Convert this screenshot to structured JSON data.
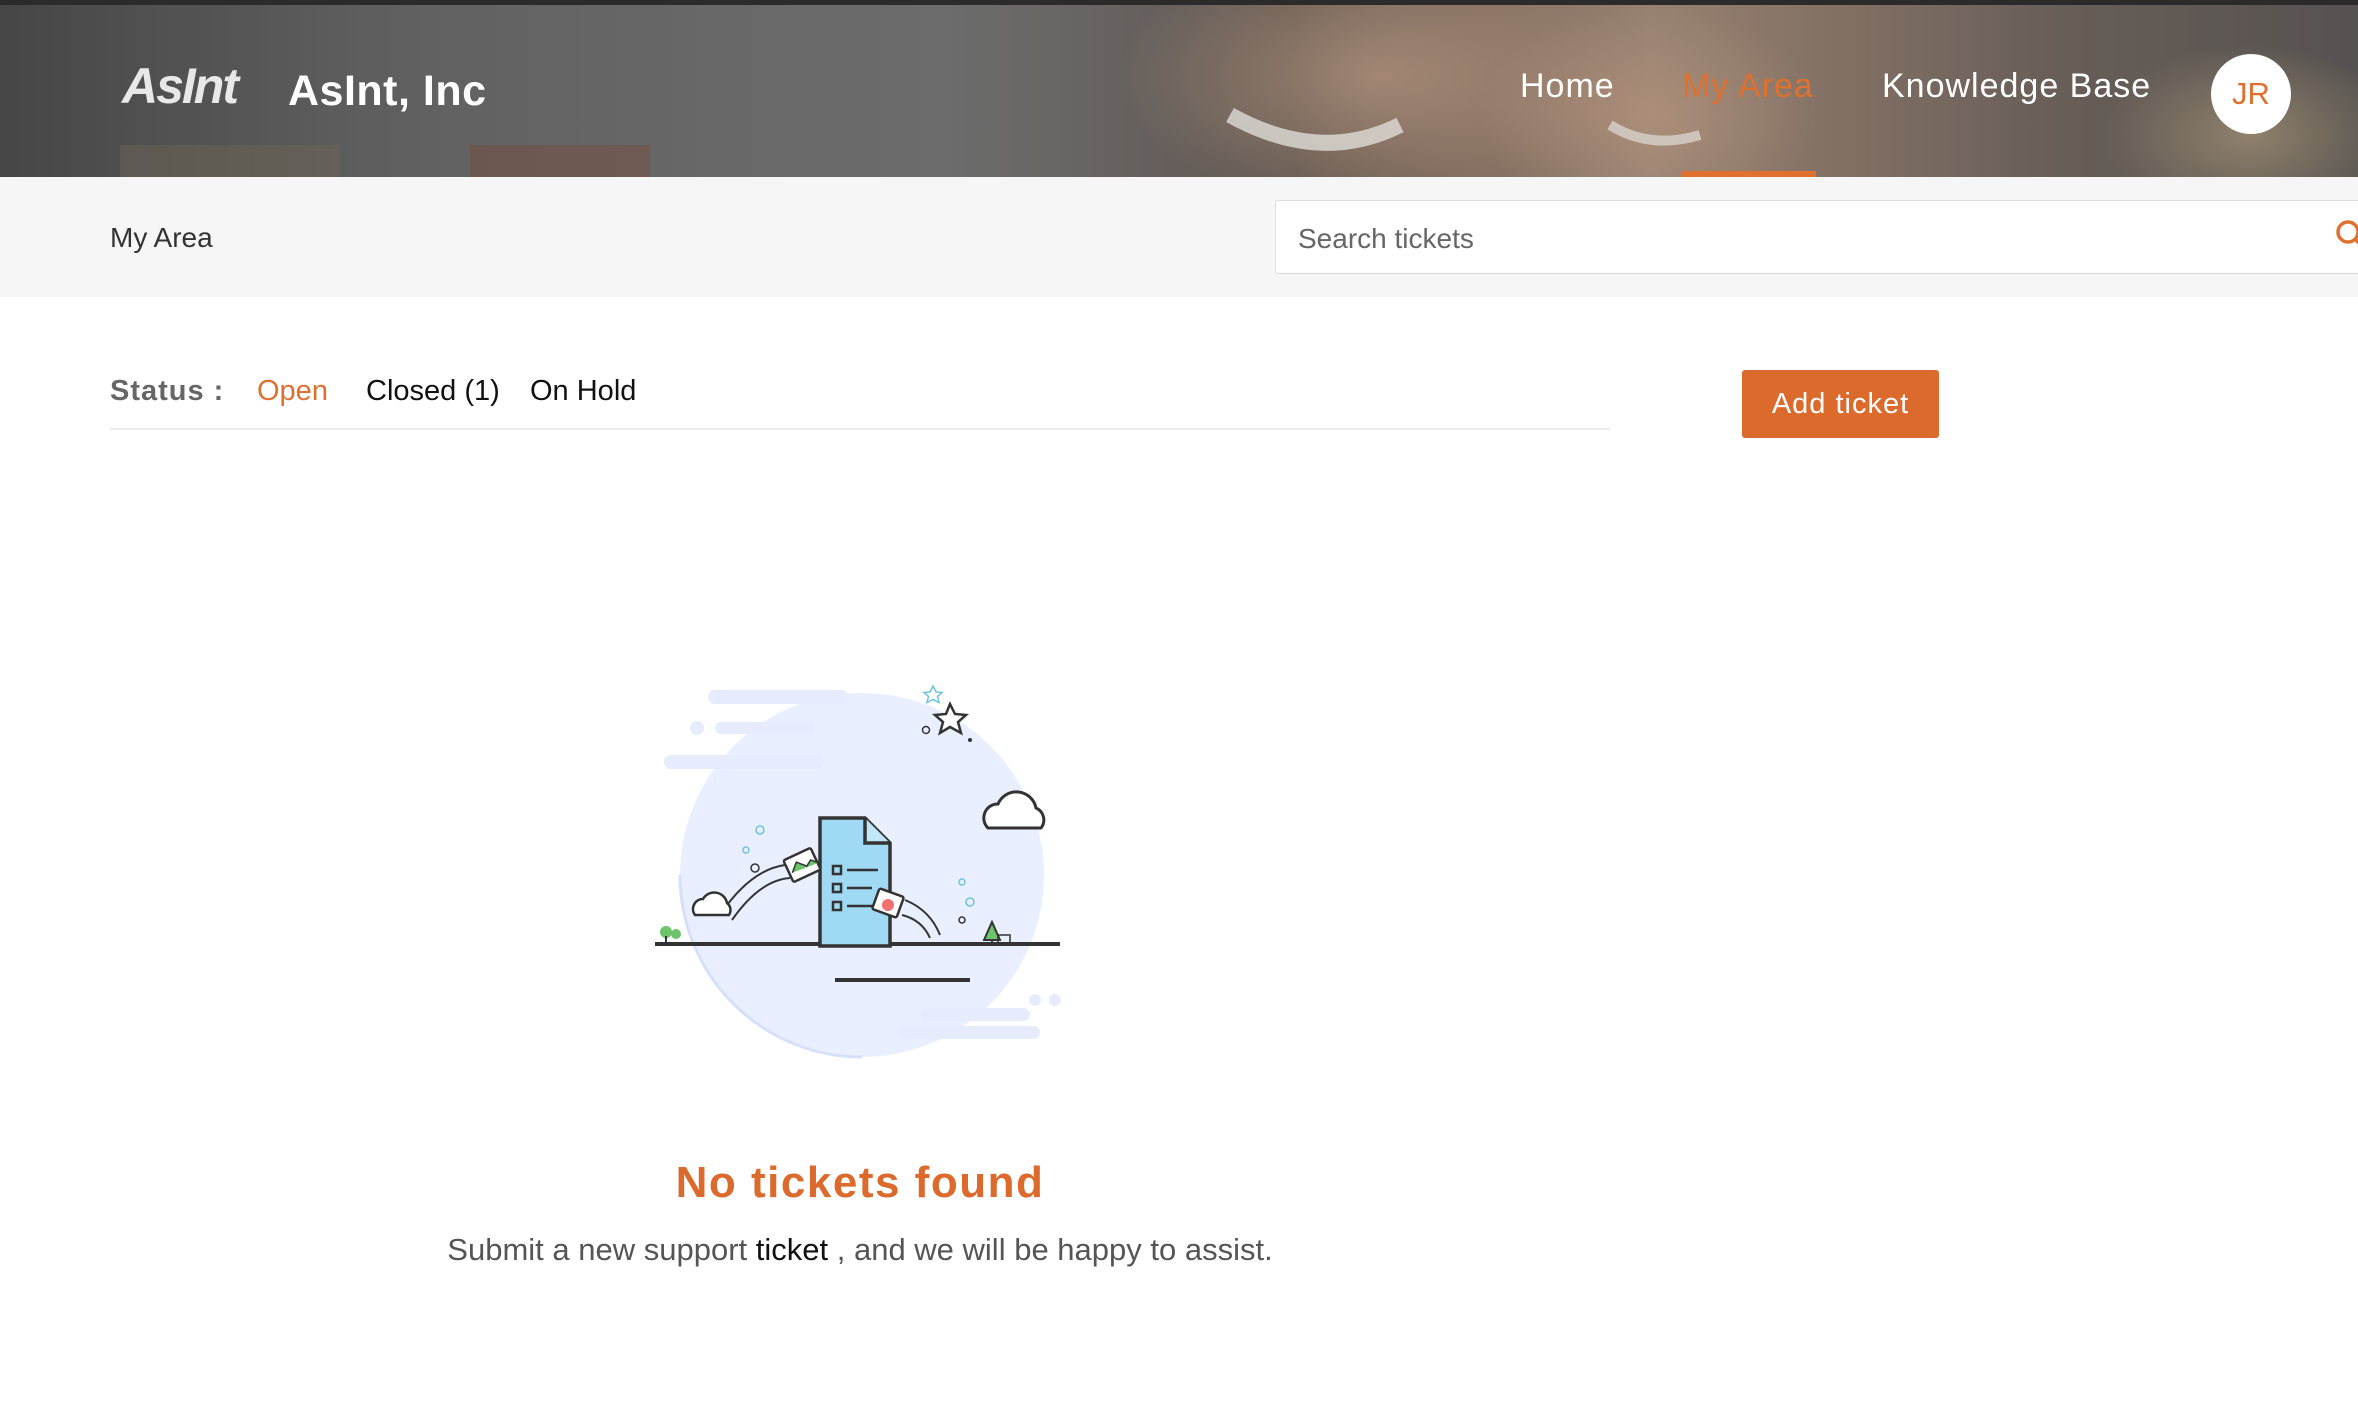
{
  "header": {
    "logo_text": "AsInt",
    "brand": "AsInt, Inc",
    "nav": [
      {
        "label": "Home",
        "active": false
      },
      {
        "label": "My Area",
        "active": true
      },
      {
        "label": "Knowledge Base",
        "active": false
      }
    ],
    "avatar_initials": "JR"
  },
  "subbar": {
    "breadcrumb": "My Area",
    "search": {
      "placeholder": "Search tickets",
      "value": "",
      "icon": "search-icon"
    }
  },
  "status": {
    "label": "Status :",
    "tabs": [
      {
        "label": "Open",
        "active": true
      },
      {
        "label": "Closed (1)",
        "active": false
      },
      {
        "label": "On Hold",
        "active": false
      }
    ]
  },
  "actions": {
    "add_ticket": "Add ticket"
  },
  "empty_state": {
    "title": "No tickets found",
    "text_before": "Submit a new support",
    "link_text": "ticket",
    "text_after": ", and we will be happy to assist.",
    "illustration": "empty-ticket-illustration"
  },
  "colors": {
    "accent": "#dc6a2d",
    "subbar": "#f6f6f6",
    "illustration_bg": "#e9efff",
    "document": "#9fd9f3"
  }
}
